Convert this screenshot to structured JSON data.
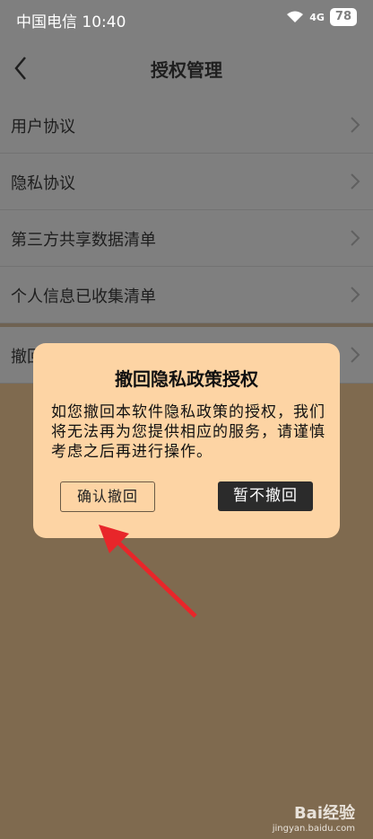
{
  "status": {
    "carrier_time": "中国电信 10:40",
    "network": "4G",
    "battery": "78"
  },
  "header": {
    "title": "授权管理"
  },
  "list": {
    "items": [
      {
        "label": "用户协议"
      },
      {
        "label": "隐私协议"
      },
      {
        "label": "第三方共享数据清单"
      },
      {
        "label": "个人信息已收集清单"
      },
      {
        "label": "撤回"
      }
    ]
  },
  "dialog": {
    "title": "撤回隐私政策授权",
    "message": "如您撤回本软件隐私政策的授权，我们将无法再为您提供相应的服务，请谨慎考虑之后再进行操作。",
    "confirm_label": "确认撤回",
    "cancel_label": "暂不撤回"
  },
  "watermark": {
    "brand": "Bai经验",
    "url": "jingyan.baidu.com"
  },
  "colors": {
    "dialog_bg": "#fdd4a4",
    "overlay": "#7f6a4f",
    "arrow": "#e8262a"
  }
}
